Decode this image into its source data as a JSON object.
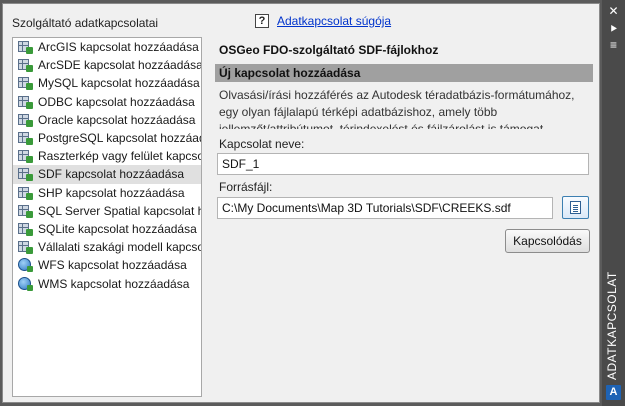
{
  "left_header": "Szolgáltató adatkapcsolatai",
  "help": {
    "icon": "?",
    "link": "Adatkapcsolat súgója"
  },
  "providers": [
    {
      "label": "ArcGIS kapcsolat hozzáadása",
      "icon": "raster-plug-icon"
    },
    {
      "label": "ArcSDE kapcsolat hozzáadása",
      "icon": "raster-plug-icon"
    },
    {
      "label": "MySQL kapcsolat hozzáadása",
      "icon": "raster-plug-icon"
    },
    {
      "label": "ODBC kapcsolat hozzáadása",
      "icon": "raster-plug-icon"
    },
    {
      "label": "Oracle kapcsolat hozzáadása",
      "icon": "raster-plug-icon"
    },
    {
      "label": "PostgreSQL kapcsolat hozzáad",
      "icon": "raster-plug-icon"
    },
    {
      "label": "Raszterkép vagy felület kapcso",
      "icon": "raster-plug-icon"
    },
    {
      "label": "SDF kapcsolat hozzáadása",
      "icon": "raster-plug-icon",
      "selected": true
    },
    {
      "label": "SHP kapcsolat hozzáadása",
      "icon": "raster-plug-icon"
    },
    {
      "label": "SQL Server Spatial kapcsolat h",
      "icon": "raster-plug-icon"
    },
    {
      "label": "SQLite kapcsolat hozzáadása",
      "icon": "raster-plug-icon"
    },
    {
      "label": "Vállalati szakági modell kapcso",
      "icon": "raster-plug-icon"
    },
    {
      "label": "WFS kapcsolat hozzáadása",
      "icon": "globe-plug-icon"
    },
    {
      "label": "WMS kapcsolat hozzáadása",
      "icon": "globe-plug-icon"
    }
  ],
  "panel": {
    "title": "OSGeo FDO-szolgáltató SDF-fájlokhoz",
    "section": "Új kapcsolat hozzáadása",
    "description": "Olvasási/írási hozzáférés az Autodesk téradatbázis-formátumához, egy olyan fájlalapú térképi adatbázishoz, amely több jellemzőt/attribútumot, térindexelést és fájlzárolást is támogat.",
    "connection_name_label": "Kapcsolat neve:",
    "connection_name_value": "SDF_1",
    "source_file_label": "Forrásfájl:",
    "source_file_value": "C:\\My Documents\\Map 3D Tutorials\\SDF\\CREEKS.sdf",
    "connect_button": "Kapcsolódás"
  },
  "side_strip": {
    "close": "✕",
    "pin": "⯈",
    "menu": "≡",
    "title": "ADATKAPCSOLAT",
    "logo": "A"
  },
  "colors": {
    "section_bar": "#a0a0a0",
    "link": "#0033cc",
    "strip": "#4a4a4a"
  }
}
